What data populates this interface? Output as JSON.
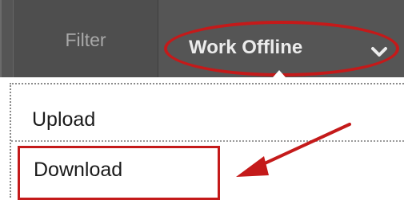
{
  "toolbar": {
    "filter_label": "Filter",
    "work_offline_label": "Work Offline",
    "work_offline_icon": "chevron-down-icon"
  },
  "menu": {
    "items": [
      {
        "label": "Upload"
      },
      {
        "label": "Download"
      }
    ]
  },
  "colors": {
    "toolbar_bg": "#555555",
    "annotation_red": "#c41a1a"
  }
}
